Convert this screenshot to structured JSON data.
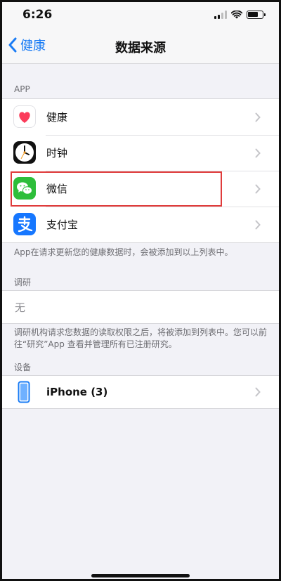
{
  "status": {
    "time": "6:26",
    "battery_level": 0.75
  },
  "nav": {
    "back_label": "健康",
    "title": "数据来源"
  },
  "apps_section": {
    "header": "APP",
    "items": [
      {
        "label": "健康",
        "icon": "health-heart-icon"
      },
      {
        "label": "时钟",
        "icon": "clock-icon"
      },
      {
        "label": "微信",
        "icon": "wechat-icon",
        "highlighted": true
      },
      {
        "label": "支付宝",
        "icon": "alipay-icon"
      }
    ],
    "footer": "App在请求更新您的健康数据时，会被添加到以上列表中。"
  },
  "research_section": {
    "header": "调研",
    "empty_label": "无",
    "footer": "调研机构请求您数据的读取权限之后，将被添加到列表中。您可以前往“研究”App 查看并管理所有已注册研究。"
  },
  "devices_section": {
    "header": "设备",
    "items": [
      {
        "label": "iPhone (3)",
        "icon": "iphone-icon"
      }
    ]
  },
  "colors": {
    "accent": "#1a7cf5",
    "highlight": "#e03b3b",
    "wechat": "#2dbe3a",
    "alipay": "#1677ff"
  }
}
